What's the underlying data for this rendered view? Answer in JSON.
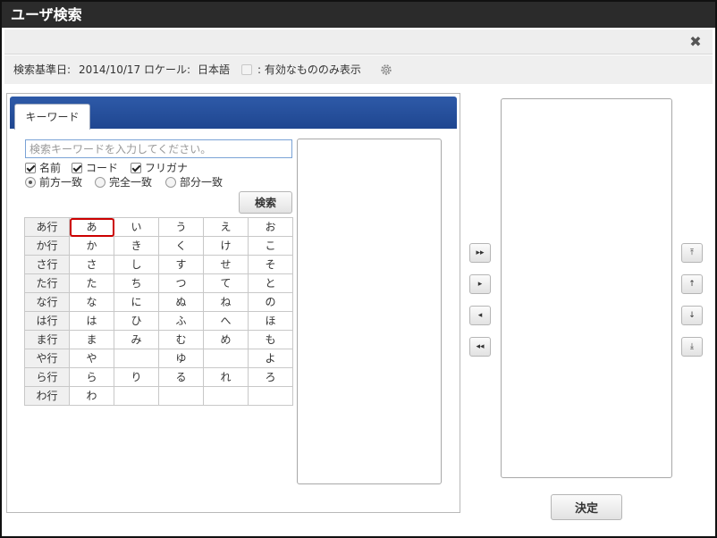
{
  "window": {
    "title": "ユーザ検索",
    "close_icon": "close-icon"
  },
  "info": {
    "base_date_label": "検索基準日:",
    "base_date": "2014/10/17",
    "locale_label": "ロケール:",
    "locale": "日本語",
    "valid_only_label": ": 有効なもののみ表示",
    "settings_icon": "gear-icon"
  },
  "tabs": [
    {
      "label": "キーワード"
    }
  ],
  "search": {
    "placeholder": "検索キーワードを入力してください。",
    "value": "",
    "fields": [
      {
        "label": "名前",
        "checked": true
      },
      {
        "label": "コード",
        "checked": true
      },
      {
        "label": "フリガナ",
        "checked": true
      }
    ],
    "match_modes": [
      {
        "label": "前方一致",
        "selected": true
      },
      {
        "label": "完全一致",
        "selected": false
      },
      {
        "label": "部分一致",
        "selected": false
      }
    ],
    "button_label": "検索"
  },
  "kana_rows": [
    {
      "head": "あ行",
      "chars": [
        "あ",
        "い",
        "う",
        "え",
        "お"
      ]
    },
    {
      "head": "か行",
      "chars": [
        "か",
        "き",
        "く",
        "け",
        "こ"
      ]
    },
    {
      "head": "さ行",
      "chars": [
        "さ",
        "し",
        "す",
        "せ",
        "そ"
      ]
    },
    {
      "head": "た行",
      "chars": [
        "た",
        "ち",
        "つ",
        "て",
        "と"
      ]
    },
    {
      "head": "な行",
      "chars": [
        "な",
        "に",
        "ぬ",
        "ね",
        "の"
      ]
    },
    {
      "head": "は行",
      "chars": [
        "は",
        "ひ",
        "ふ",
        "へ",
        "ほ"
      ]
    },
    {
      "head": "ま行",
      "chars": [
        "ま",
        "み",
        "む",
        "め",
        "も"
      ]
    },
    {
      "head": "や行",
      "chars": [
        "や",
        "",
        "ゆ",
        "",
        "よ"
      ]
    },
    {
      "head": "ら行",
      "chars": [
        "ら",
        "り",
        "る",
        "れ",
        "ろ"
      ]
    },
    {
      "head": "わ行",
      "chars": [
        "わ",
        "",
        "",
        "",
        ""
      ]
    }
  ],
  "selected_kana": "あ",
  "transfer_buttons": {
    "add_all": "▸▸",
    "add": "▸",
    "remove": "◂",
    "remove_all": "◂◂"
  },
  "order_buttons": {
    "top": "⤒",
    "up": "↑",
    "down": "↓",
    "bottom": "⤓"
  },
  "decide_label": "決定"
}
